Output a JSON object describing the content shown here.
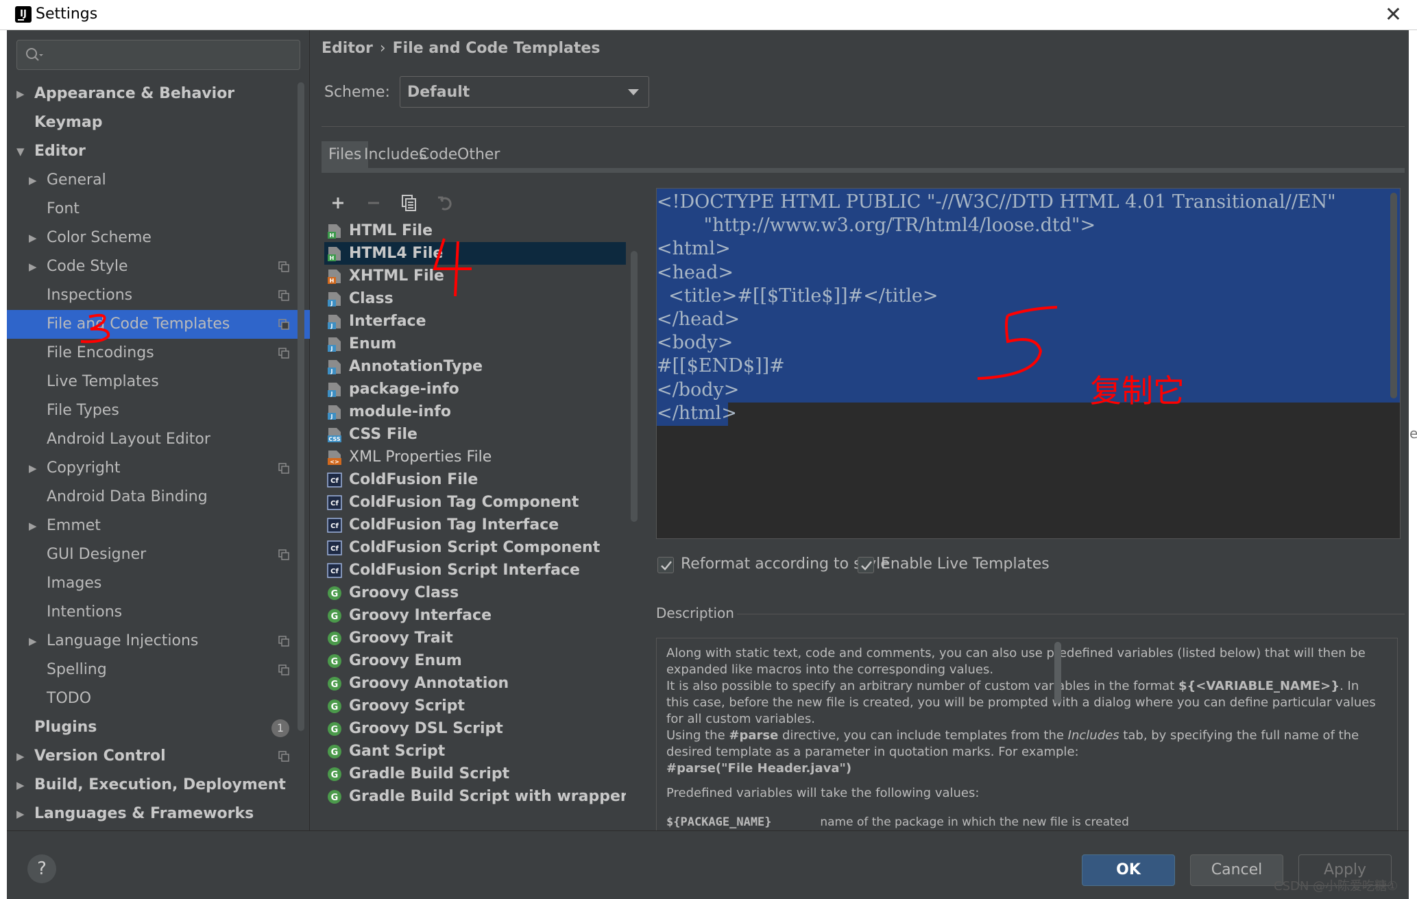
{
  "window": {
    "title": "Settings"
  },
  "sidebar": {
    "items": [
      {
        "label": "Appearance & Behavior",
        "level": 0,
        "expandable": true,
        "expanded": false,
        "bold": true
      },
      {
        "label": "Keymap",
        "level": 0,
        "expandable": false,
        "bold": true
      },
      {
        "label": "Editor",
        "level": 0,
        "expandable": true,
        "expanded": true,
        "bold": true
      },
      {
        "label": "General",
        "level": 1,
        "expandable": true,
        "expanded": false
      },
      {
        "label": "Font",
        "level": 1,
        "expandable": false
      },
      {
        "label": "Color Scheme",
        "level": 1,
        "expandable": true,
        "expanded": false
      },
      {
        "label": "Code Style",
        "level": 1,
        "expandable": true,
        "expanded": false,
        "project": true
      },
      {
        "label": "Inspections",
        "level": 1,
        "expandable": false,
        "project": true
      },
      {
        "label": "File and Code Templates",
        "level": 1,
        "expandable": false,
        "project": true,
        "selected": true
      },
      {
        "label": "File Encodings",
        "level": 1,
        "expandable": false,
        "project": true
      },
      {
        "label": "Live Templates",
        "level": 1,
        "expandable": false
      },
      {
        "label": "File Types",
        "level": 1,
        "expandable": false
      },
      {
        "label": "Android Layout Editor",
        "level": 1,
        "expandable": false
      },
      {
        "label": "Copyright",
        "level": 1,
        "expandable": true,
        "expanded": false,
        "project": true
      },
      {
        "label": "Android Data Binding",
        "level": 1,
        "expandable": false
      },
      {
        "label": "Emmet",
        "level": 1,
        "expandable": true,
        "expanded": false
      },
      {
        "label": "GUI Designer",
        "level": 1,
        "expandable": false,
        "project": true
      },
      {
        "label": "Images",
        "level": 1,
        "expandable": false
      },
      {
        "label": "Intentions",
        "level": 1,
        "expandable": false
      },
      {
        "label": "Language Injections",
        "level": 1,
        "expandable": true,
        "expanded": false,
        "project": true
      },
      {
        "label": "Spelling",
        "level": 1,
        "expandable": false,
        "project": true
      },
      {
        "label": "TODO",
        "level": 1,
        "expandable": false
      },
      {
        "label": "Plugins",
        "level": 0,
        "expandable": false,
        "bold": true,
        "badge": "1"
      },
      {
        "label": "Version Control",
        "level": 0,
        "expandable": true,
        "expanded": false,
        "bold": true,
        "project": true
      },
      {
        "label": "Build, Execution, Deployment",
        "level": 0,
        "expandable": true,
        "expanded": false,
        "bold": true
      },
      {
        "label": "Languages & Frameworks",
        "level": 0,
        "expandable": true,
        "expanded": false,
        "bold": true
      }
    ]
  },
  "breadcrumb": {
    "part1": "Editor",
    "separator": "›",
    "part2": "File and Code Templates"
  },
  "scheme": {
    "label": "Scheme:",
    "value": "Default"
  },
  "tabs": [
    "Files",
    "Includes",
    "Code",
    "Other"
  ],
  "templates": [
    {
      "name": "HTML File",
      "icon": "html-file-icon",
      "tag": "H",
      "color": "#3c9a4b",
      "bold": true
    },
    {
      "name": "HTML4 File",
      "icon": "html-file-icon",
      "tag": "H",
      "color": "#3c9a4b",
      "bold": true,
      "selected": true
    },
    {
      "name": "XHTML File",
      "icon": "xhtml-file-icon",
      "tag": "H",
      "color": "#d2691e",
      "bold": true
    },
    {
      "name": "Class",
      "icon": "java-class-icon",
      "tag": "J",
      "color": "#3d8fc4",
      "bold": true
    },
    {
      "name": "Interface",
      "icon": "java-interface-icon",
      "tag": "J",
      "color": "#3d8fc4",
      "bold": true
    },
    {
      "name": "Enum",
      "icon": "java-enum-icon",
      "tag": "J",
      "color": "#3d8fc4",
      "bold": true
    },
    {
      "name": "AnnotationType",
      "icon": "java-annotation-icon",
      "tag": "J",
      "color": "#3d8fc4",
      "bold": true
    },
    {
      "name": "package-info",
      "icon": "java-file-icon",
      "tag": "J",
      "color": "#3d8fc4",
      "bold": true
    },
    {
      "name": "module-info",
      "icon": "java-file-icon",
      "tag": "J",
      "color": "#3d8fc4",
      "bold": true
    },
    {
      "name": "CSS File",
      "icon": "css-file-icon",
      "tag": "CSS",
      "color": "#3d8fc4",
      "bold": true
    },
    {
      "name": "XML Properties File",
      "icon": "xml-file-icon",
      "tag": "<>",
      "color": "#d2691e",
      "bold": false
    },
    {
      "name": "ColdFusion File",
      "icon": "coldfusion-icon",
      "tag": "Cf",
      "color": "#3d6fc4",
      "bold": true
    },
    {
      "name": "ColdFusion Tag Component",
      "icon": "coldfusion-icon",
      "tag": "Cf",
      "color": "#3d6fc4",
      "bold": true
    },
    {
      "name": "ColdFusion Tag Interface",
      "icon": "coldfusion-icon",
      "tag": "Cf",
      "color": "#3d6fc4",
      "bold": true
    },
    {
      "name": "ColdFusion Script Component",
      "icon": "coldfusion-icon",
      "tag": "Cf",
      "color": "#3d6fc4",
      "bold": true
    },
    {
      "name": "ColdFusion Script Interface",
      "icon": "coldfusion-icon",
      "tag": "Cf",
      "color": "#3d6fc4",
      "bold": true
    },
    {
      "name": "Groovy Class",
      "icon": "groovy-icon",
      "tag": "G",
      "color": "#4b9a4b",
      "bold": true
    },
    {
      "name": "Groovy Interface",
      "icon": "groovy-icon",
      "tag": "G",
      "color": "#4b9a4b",
      "bold": true
    },
    {
      "name": "Groovy Trait",
      "icon": "groovy-icon",
      "tag": "G",
      "color": "#4b9a4b",
      "bold": true
    },
    {
      "name": "Groovy Enum",
      "icon": "groovy-icon",
      "tag": "G",
      "color": "#4b9a4b",
      "bold": true
    },
    {
      "name": "Groovy Annotation",
      "icon": "groovy-icon",
      "tag": "G",
      "color": "#4b9a4b",
      "bold": true
    },
    {
      "name": "Groovy Script",
      "icon": "groovy-icon",
      "tag": "G",
      "color": "#4b9a4b",
      "bold": true
    },
    {
      "name": "Groovy DSL Script",
      "icon": "groovy-icon",
      "tag": "G",
      "color": "#4b9a4b",
      "bold": true
    },
    {
      "name": "Gant Script",
      "icon": "groovy-icon",
      "tag": "G",
      "color": "#4b9a4b",
      "bold": true
    },
    {
      "name": "Gradle Build Script",
      "icon": "groovy-icon",
      "tag": "G",
      "color": "#4b9a4b",
      "bold": true
    },
    {
      "name": "Gradle Build Script with wrapper",
      "icon": "groovy-icon",
      "tag": "G",
      "color": "#4b9a4b",
      "bold": true
    }
  ],
  "editor": {
    "lines": [
      "<!DOCTYPE HTML PUBLIC \"-//W3C//DTD HTML 4.01 Transitional//EN\"",
      "        \"http://www.w3.org/TR/html4/loose.dtd\">",
      "<html>",
      "<head>",
      "  <title>#[[$Title$]]#</title>",
      "</head>",
      "<body>",
      "#[[$END$]]#",
      "</body>",
      "</html>"
    ]
  },
  "options": {
    "reformat_label": "Reformat according to style",
    "reformat_checked": true,
    "live_templates_label": "Enable Live Templates",
    "live_templates_checked": true
  },
  "description": {
    "title": "Description",
    "p1": "Along with static text, code and comments, you can also use predefined variables (listed below) that will then be expanded like macros into the corresponding values.",
    "p2a": "It is also possible to specify an arbitrary number of custom variables in the format ",
    "p2b": "${<VARIABLE_NAME>}",
    "p2c": ". In this case, before the new file is created, you will be prompted with a dialog where you can define particular values for all custom variables.",
    "p3a": "Using the ",
    "p3b": "#parse",
    "p3c": " directive, you can include templates from the ",
    "p3d": "Includes",
    "p3e": " tab, by specifying the full name of the desired template as a parameter in quotation marks. For example:",
    "p4": "#parse(\"File Header.java\")",
    "p5": "Predefined variables will take the following values:",
    "var_name": "${PACKAGE_NAME}",
    "var_desc": "name of the package in which the new file is created"
  },
  "buttons": {
    "help": "?",
    "ok": "OK",
    "cancel": "Cancel",
    "apply": "Apply"
  },
  "annotations": {
    "mark3": "3",
    "mark4": "4",
    "mark5": "5",
    "copy_note": "复制它"
  },
  "watermark": "CSDN @小陈爱吃糖①",
  "edge_char": "e",
  "colors": {
    "background": "#3c3f41",
    "editor_bg": "#2b2b2b",
    "selection": "#214283",
    "sidebar_selected": "#2f65ca",
    "list_selected": "#0d293e",
    "ok_button": "#365880",
    "annotation_red": "#ff0000"
  }
}
